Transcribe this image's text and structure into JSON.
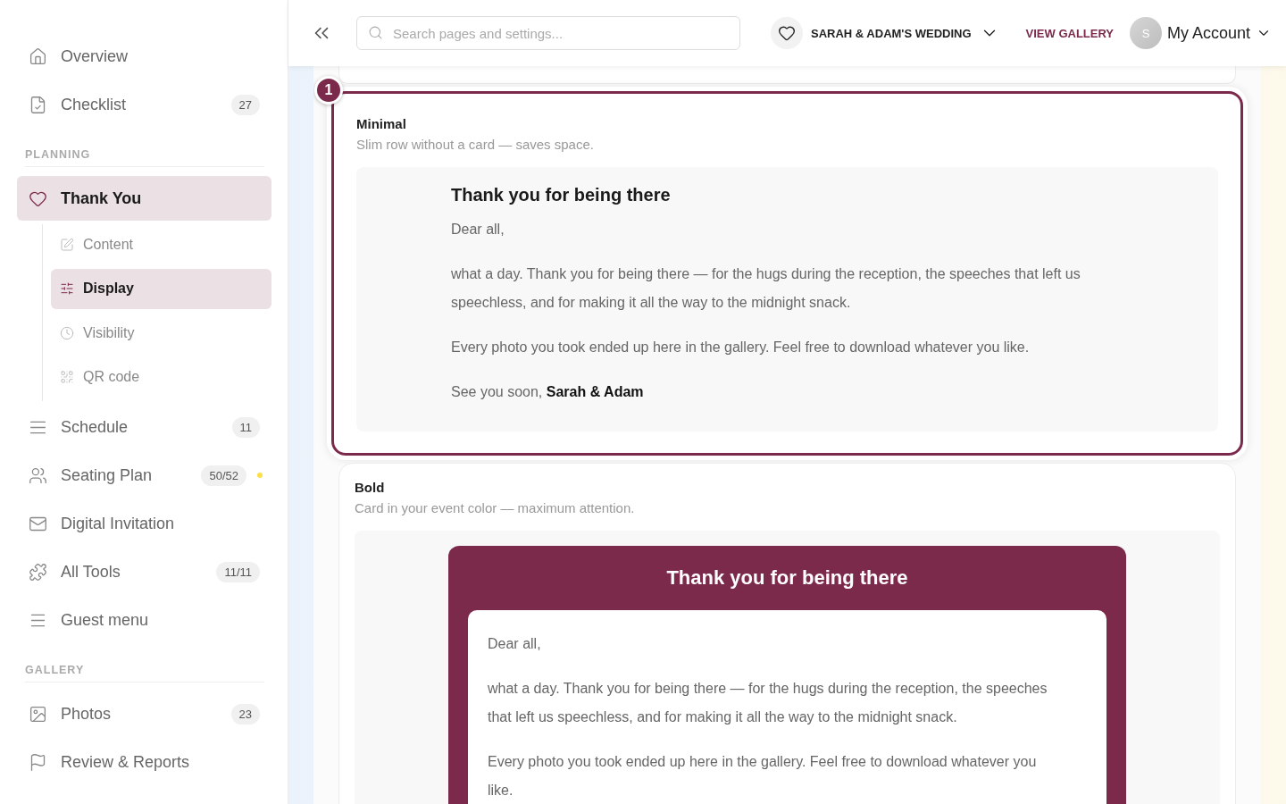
{
  "sidebar": {
    "items": [
      {
        "label": "Overview",
        "selected": false
      },
      {
        "label": "Checklist",
        "badge": "27",
        "selected": false
      }
    ],
    "sections": [
      {
        "heading": "PLANNING",
        "items": [
          {
            "label": "Thank You",
            "selected": true,
            "expanded": true,
            "children": [
              {
                "label": "Content",
                "selected": false
              },
              {
                "label": "Display",
                "selected": true
              },
              {
                "label": "Visibility",
                "selected": false
              },
              {
                "label": "QR code",
                "selected": false
              }
            ]
          },
          {
            "label": "Schedule",
            "badge": "11",
            "selected": false
          },
          {
            "label": "Seating Plan",
            "badge": "50/52",
            "alert": true,
            "selected": false
          },
          {
            "label": "Digital Invitation",
            "selected": false
          },
          {
            "label": "All Tools",
            "badge": "11/11",
            "selected": false
          },
          {
            "label": "Guest menu",
            "selected": false
          }
        ]
      },
      {
        "heading": "GALLERY",
        "items": [
          {
            "label": "Photos",
            "badge": "23",
            "selected": false
          },
          {
            "label": "Review & Reports",
            "selected": false
          }
        ]
      }
    ]
  },
  "header": {
    "search": {
      "placeholder": "Search pages and settings..."
    },
    "event": "SARAH & ADAM'S WEDDING",
    "gallery_link": "VIEW GALLERY",
    "avatar": "S",
    "account": "My Account"
  },
  "options": [
    {
      "kind": "minimal",
      "selected": true,
      "number": "1",
      "title": "Minimal",
      "description": "Slim row without a card — saves space.",
      "preview": {
        "heading": "Thank you for being there",
        "paragraphs": [
          "Dear all,",
          "what a day. Thank you for being there — for the hugs during the reception, the speeches that left us speechless, and for making it all the way to the midnight snack.",
          "Every photo you took ended up here in the gallery. Feel free to download whatever you like.",
          "See you soon, **Sarah & Adam**"
        ]
      }
    },
    {
      "kind": "bold",
      "selected": false,
      "title": "Bold",
      "description": "Card in your event color — maximum attention.",
      "preview": {
        "heading": "Thank you for being there",
        "paragraphs": [
          "Dear all,",
          "what a day. Thank you for being there — for the hugs during the reception, the speeches that left us speechless, and for making it all the way to the midnight snack.",
          "Every photo you took ended up here in the gallery. Feel free to download whatever you like."
        ]
      }
    }
  ]
}
